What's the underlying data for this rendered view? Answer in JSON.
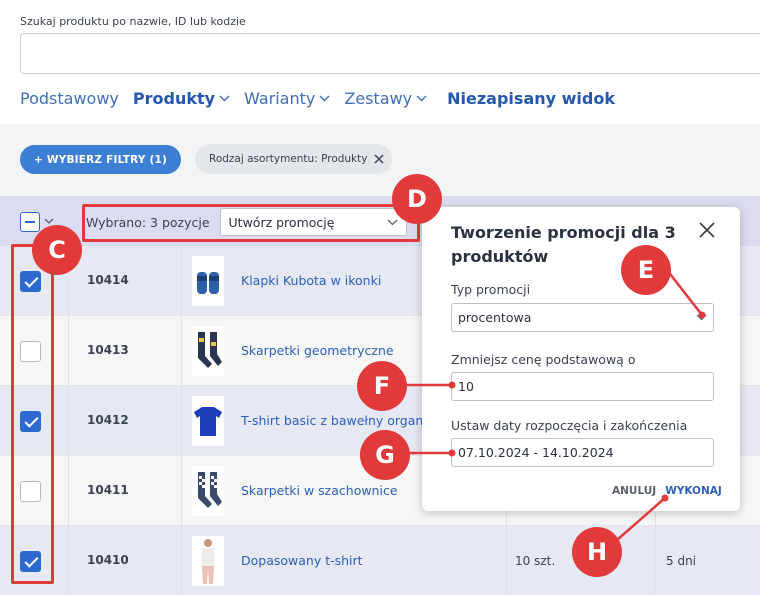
{
  "search": {
    "label": "Szukaj produktu po nazwie, ID lub kodzie",
    "placeholder": ""
  },
  "views": [
    {
      "label": "Podstawowy",
      "dropdown": false
    },
    {
      "label": "Produkty",
      "dropdown": true
    },
    {
      "label": "Warianty",
      "dropdown": true
    },
    {
      "label": "Zestawy",
      "dropdown": true
    }
  ],
  "unsaved_view": "Niezapisany widok",
  "filters": {
    "button": "+ WYBIERZ FILTRY (1)",
    "chip": "Rodzaj asortymentu: Produkty"
  },
  "selection": {
    "text": "Wybrano: 3 pozycje",
    "action": "Utwórz promocję"
  },
  "rows": [
    {
      "id": "10414",
      "name": "Klapki Kubota w ikonki",
      "checked": true,
      "qty": "",
      "days": ""
    },
    {
      "id": "10413",
      "name": "Skarpetki geometryczne",
      "checked": false,
      "qty": "",
      "days": ""
    },
    {
      "id": "10412",
      "name": "T-shirt basic z bawełny organicz",
      "checked": true,
      "qty": "",
      "days": ""
    },
    {
      "id": "10411",
      "name": "Skarpetki w szachownice",
      "checked": false,
      "qty": "",
      "days": ""
    },
    {
      "id": "10410",
      "name": "Dopasowany t-shirt",
      "checked": true,
      "qty": "10 szt.",
      "days": "5 dni"
    }
  ],
  "popup": {
    "title": "Tworzenie promocji dla 3 produktów",
    "type_label": "Typ promocji",
    "type_value": "procentowa",
    "reduce_label": "Zmniejsz cenę podstawową o",
    "reduce_value": "10",
    "dates_label": "Ustaw daty rozpoczęcia i zakończenia",
    "dates_value": "07.10.2024 - 14.10.2024",
    "cancel": "ANULUJ",
    "confirm": "WYKONAJ"
  },
  "badges": {
    "c": "C",
    "d": "D",
    "e": "E",
    "f": "F",
    "g": "G",
    "h": "H"
  },
  "colors": {
    "accent": "#2d6ad0",
    "annotation": "#e23a3a",
    "header_bg": "#dcdcf0",
    "selected_row_bg": "#e6e8f4"
  }
}
